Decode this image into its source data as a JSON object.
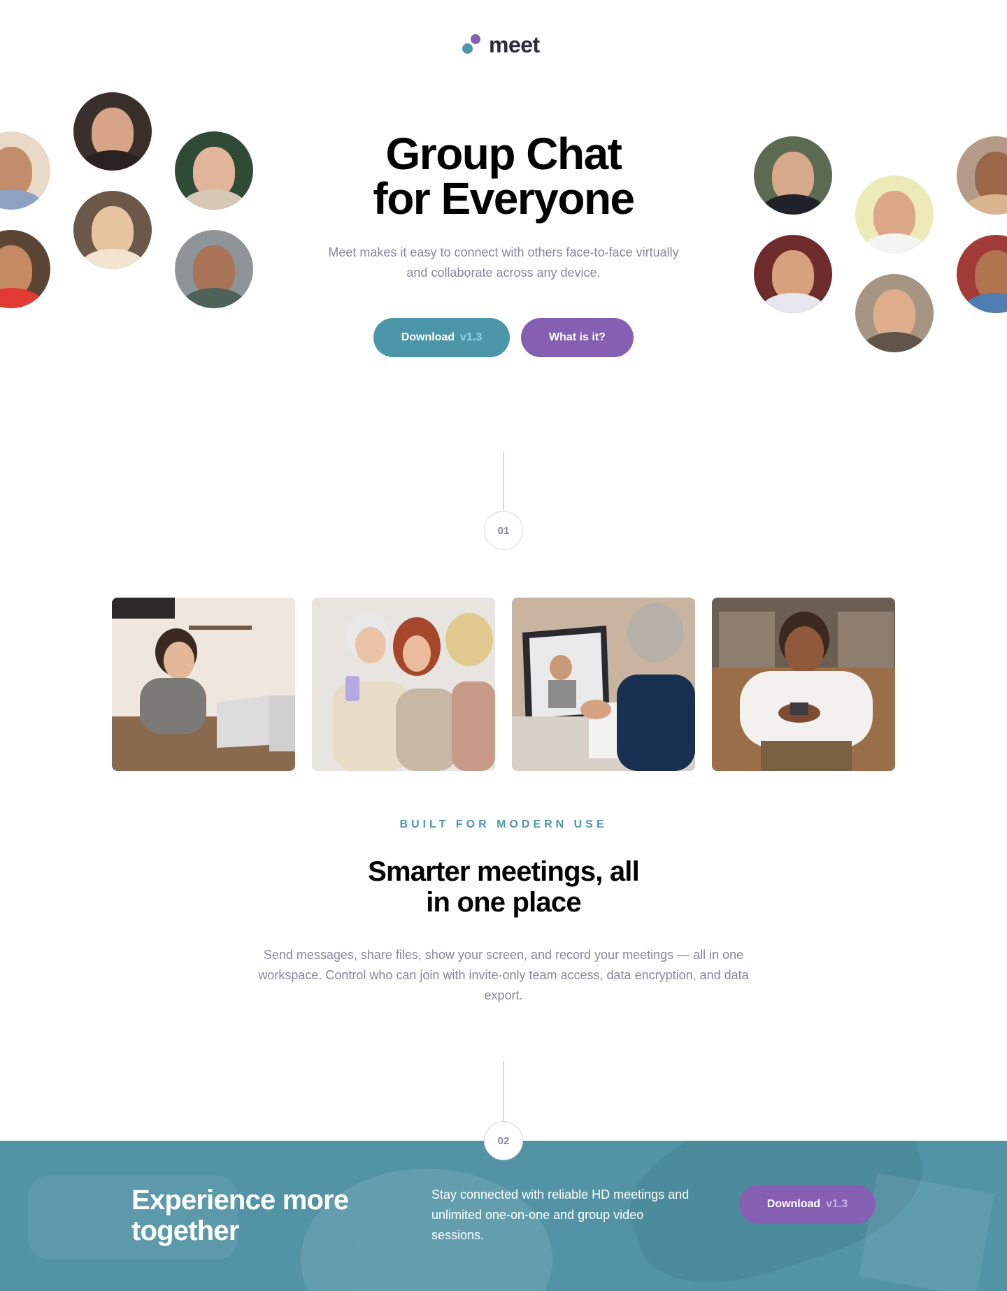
{
  "brand": {
    "name": "meet",
    "colors": {
      "teal": "#4d96a9",
      "purple": "#855fb1",
      "dark": "#2a2a3d",
      "muted": "#87879d"
    }
  },
  "hero": {
    "title_line1": "Group Chat",
    "title_line2": "for Everyone",
    "subtitle": "Meet makes it easy to connect with others face-to-face virtually and collaborate across any device.",
    "download_label": "Download",
    "download_version": "v1.3",
    "what_label": "What is it?"
  },
  "steps": {
    "first": "01",
    "second": "02"
  },
  "features": {
    "eyebrow": "BUILT FOR MODERN USE",
    "title_line1": "Smarter meetings, all",
    "title_line2": "in one place",
    "body": "Send messages, share files, show your screen, and record your meetings — all in one workspace. Control who can join with invite-only team access, data encryption, and data export."
  },
  "cta": {
    "title_line1": "Experience more",
    "title_line2": "together",
    "body": "Stay connected with reliable HD meetings and unlimited one-on-one and group video sessions.",
    "download_label": "Download",
    "download_version": "v1.3"
  },
  "icons": {
    "logo": "meet-logo-icon"
  }
}
